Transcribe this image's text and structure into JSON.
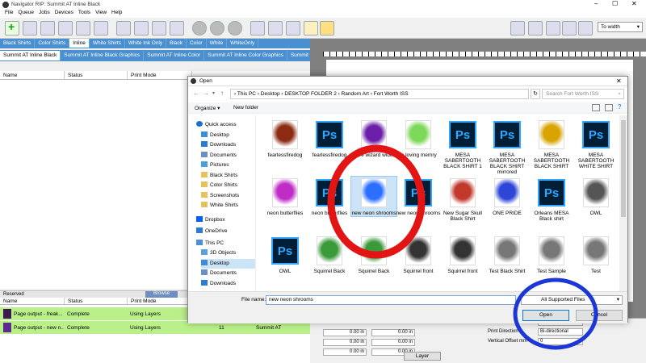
{
  "window_title": "Navigator RIP: Summit AT Inline Black",
  "menu": [
    "File",
    "Queue",
    "Jobs",
    "Devices",
    "Tools",
    "View",
    "Help"
  ],
  "zoom_select": "To width",
  "queue_tabs": [
    "Black Shirts",
    "Color Shirts",
    "Inline",
    "White Shirts",
    "White Ink Only",
    "Black",
    "Color",
    "White",
    "WhiteOnly"
  ],
  "printer_tabs": [
    "Summit AT Inline Black",
    "Summit AT Inline Black Graphics",
    "Summit AT Inline Color",
    "Summit AT Inline Color Graphics",
    "Summit S20 Inline Black"
  ],
  "top_grid_headers": {
    "name": "Name",
    "status": "Status",
    "print_mode": "Print Mode"
  },
  "reserved_bar": {
    "label": "Reserved",
    "browse": "Browse"
  },
  "bottom_grid_headers": {
    "name": "Name",
    "status": "Status",
    "print_mode": "Print Mode"
  },
  "bottom_rows": [
    {
      "name": "Page output - freak...",
      "status": "Complete",
      "mode": "Using Layers",
      "extra": ""
    },
    {
      "name": "Page output - new n...",
      "status": "Complete",
      "mode": "Using Layers",
      "num": "11",
      "device": "Summit AT"
    }
  ],
  "props": {
    "h_offset": "Horizontal Offset mm",
    "h_offset_val": "0",
    "print_dir": "Print Direction",
    "print_dir_val": "Bi-directional",
    "v_offset": "Vertical Offset mm",
    "v_offset_val": "0",
    "in_vals": [
      "0.00 in",
      "0.00 in",
      "0.00 in",
      "0.00 in",
      "0.00 in",
      "0.00 in"
    ],
    "layer_button": "Layer"
  },
  "dialog": {
    "title": "Open",
    "path": [
      "This PC",
      "Desktop",
      "DESKTOP FOLDER 2",
      "Random Art",
      "Fort Worth ISS"
    ],
    "search_placeholder": "Search Fort Worth ISS",
    "organize": "Organize ▾",
    "new_folder": "New folder",
    "nav": [
      {
        "label": "Quick access",
        "type": "star"
      },
      {
        "label": "Desktop",
        "type": "desk"
      },
      {
        "label": "Downloads",
        "type": "dl"
      },
      {
        "label": "Documents",
        "type": "doc"
      },
      {
        "label": "Pictures",
        "type": "pic"
      },
      {
        "label": "Black Shirts",
        "type": "folder"
      },
      {
        "label": "Color Shirts",
        "type": "folder"
      },
      {
        "label": "Screenshots",
        "type": "folder"
      },
      {
        "label": "White Shirts",
        "type": "folder"
      },
      {
        "label": "Dropbox",
        "type": "dropbox"
      },
      {
        "label": "OneDrive",
        "type": "cloud"
      },
      {
        "label": "This PC",
        "type": "pc"
      },
      {
        "label": "3D Objects",
        "type": "3d"
      },
      {
        "label": "Desktop",
        "type": "desk"
      },
      {
        "label": "Documents",
        "type": "doc"
      },
      {
        "label": "Downloads",
        "type": "dl"
      }
    ],
    "files": [
      {
        "label": "fearlessfiredog",
        "kind": "img",
        "color": "#8b2b12"
      },
      {
        "label": "fearlessfiredog",
        "kind": "ps"
      },
      {
        "label": "Fire wizard wide",
        "kind": "img",
        "color": "#6b1fa8"
      },
      {
        "label": "in loving memry",
        "kind": "img",
        "color": "#7ed85a"
      },
      {
        "label": "MESA SABERTOOTH BLACK SHIRT 1",
        "kind": "ps"
      },
      {
        "label": "MESA SABERTOOTH BLACK SHIRT mirrored",
        "kind": "ps"
      },
      {
        "label": "MESA SABERTOOTH BLACK SHIRT",
        "kind": "img",
        "color": "#d9a400"
      },
      {
        "label": "MESA SABERTOOTH WHITE SHIRT",
        "kind": "ps"
      },
      {
        "label": "neon butterflies",
        "kind": "img",
        "color": "#c02cc8"
      },
      {
        "label": "neon butterflies",
        "kind": "ps"
      },
      {
        "label": "new neon shrooms",
        "kind": "img",
        "color": "#2b6fff"
      },
      {
        "label": "new neon shrooms",
        "kind": "ps"
      },
      {
        "label": "New Sugar Skull Black Shirt",
        "kind": "img",
        "color": "#c0392b"
      },
      {
        "label": "ONE PRIDE",
        "kind": "img",
        "color": "#2d46d8"
      },
      {
        "label": "Orleans MESA Black shirt",
        "kind": "ps"
      },
      {
        "label": "OWL",
        "kind": "img",
        "color": "#555555"
      },
      {
        "label": "OWL",
        "kind": "ps"
      },
      {
        "label": "Squirrel Back",
        "kind": "img",
        "color": "#3a9a3a"
      },
      {
        "label": "Squirrel Back",
        "kind": "img",
        "color": "#3a9a3a"
      },
      {
        "label": "Squirrel front",
        "kind": "img",
        "color": "#333333"
      },
      {
        "label": "Squirrel front",
        "kind": "img",
        "color": "#333333"
      },
      {
        "label": "Test Black Shirt",
        "kind": "img",
        "color": "#777777"
      },
      {
        "label": "Test Sample",
        "kind": "img",
        "color": "#777777"
      },
      {
        "label": "Test",
        "kind": "img",
        "color": "#777777"
      }
    ],
    "filename_label": "File name:",
    "filename_value": "new neon shrooms",
    "filetype_value": "All Supported Files",
    "open_button": "Open",
    "cancel_button": "Cancel"
  }
}
